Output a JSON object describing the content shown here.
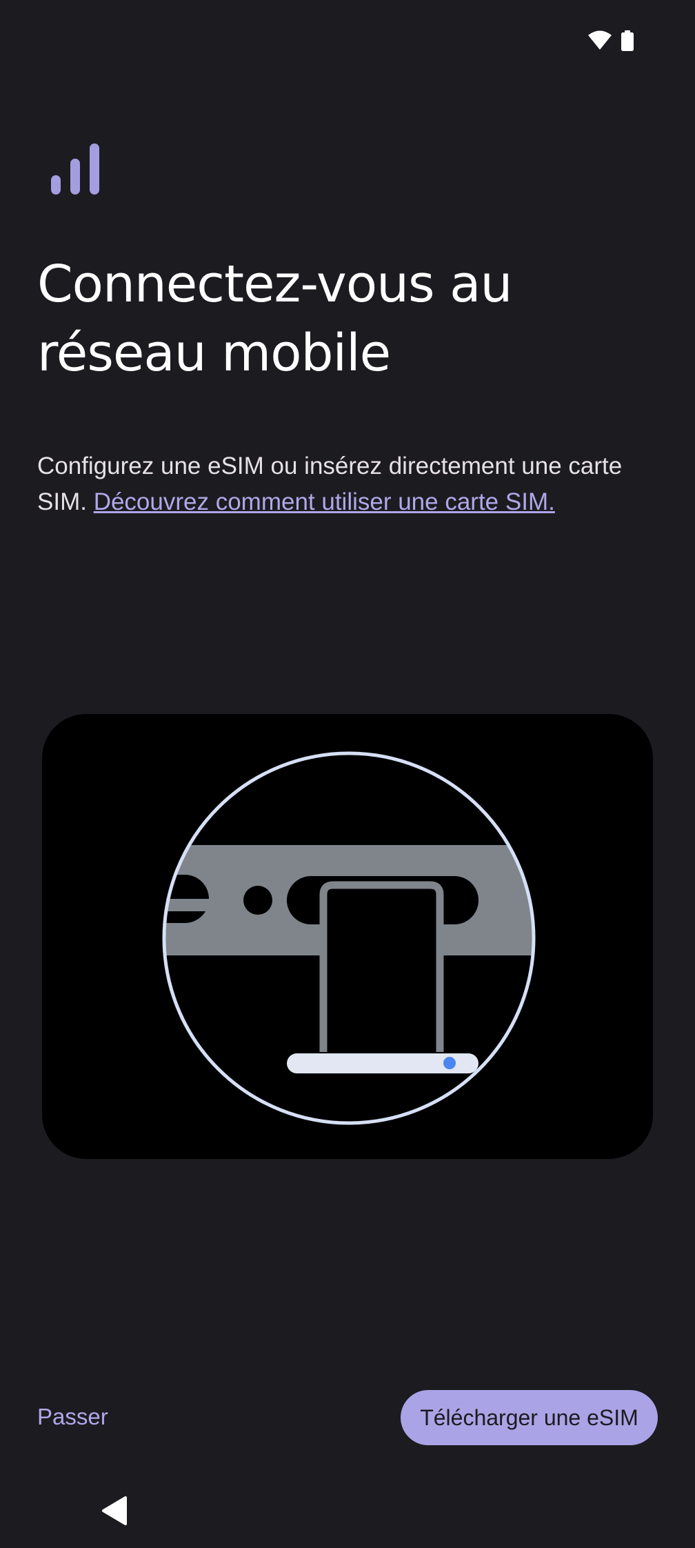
{
  "status_bar": {
    "icons": [
      "wifi-icon",
      "battery-icon"
    ]
  },
  "header": {
    "icon": "signal-icon",
    "accent_color": "#a49ee0"
  },
  "title": {
    "line1": "Connectez-vous au",
    "line2": "réseau mobile"
  },
  "description": {
    "text": "Configurez une eSIM ou insérez directement une carte SIM. ",
    "link_label": "Découvrez comment utiliser une carte SIM."
  },
  "illustration": {
    "subject": "sim-tray-illustration"
  },
  "actions": {
    "skip_label": "Passer",
    "download_label": "Télécharger une eSIM",
    "primary_color": "#aaa4e6"
  },
  "navigation": {
    "back": "back-icon"
  }
}
